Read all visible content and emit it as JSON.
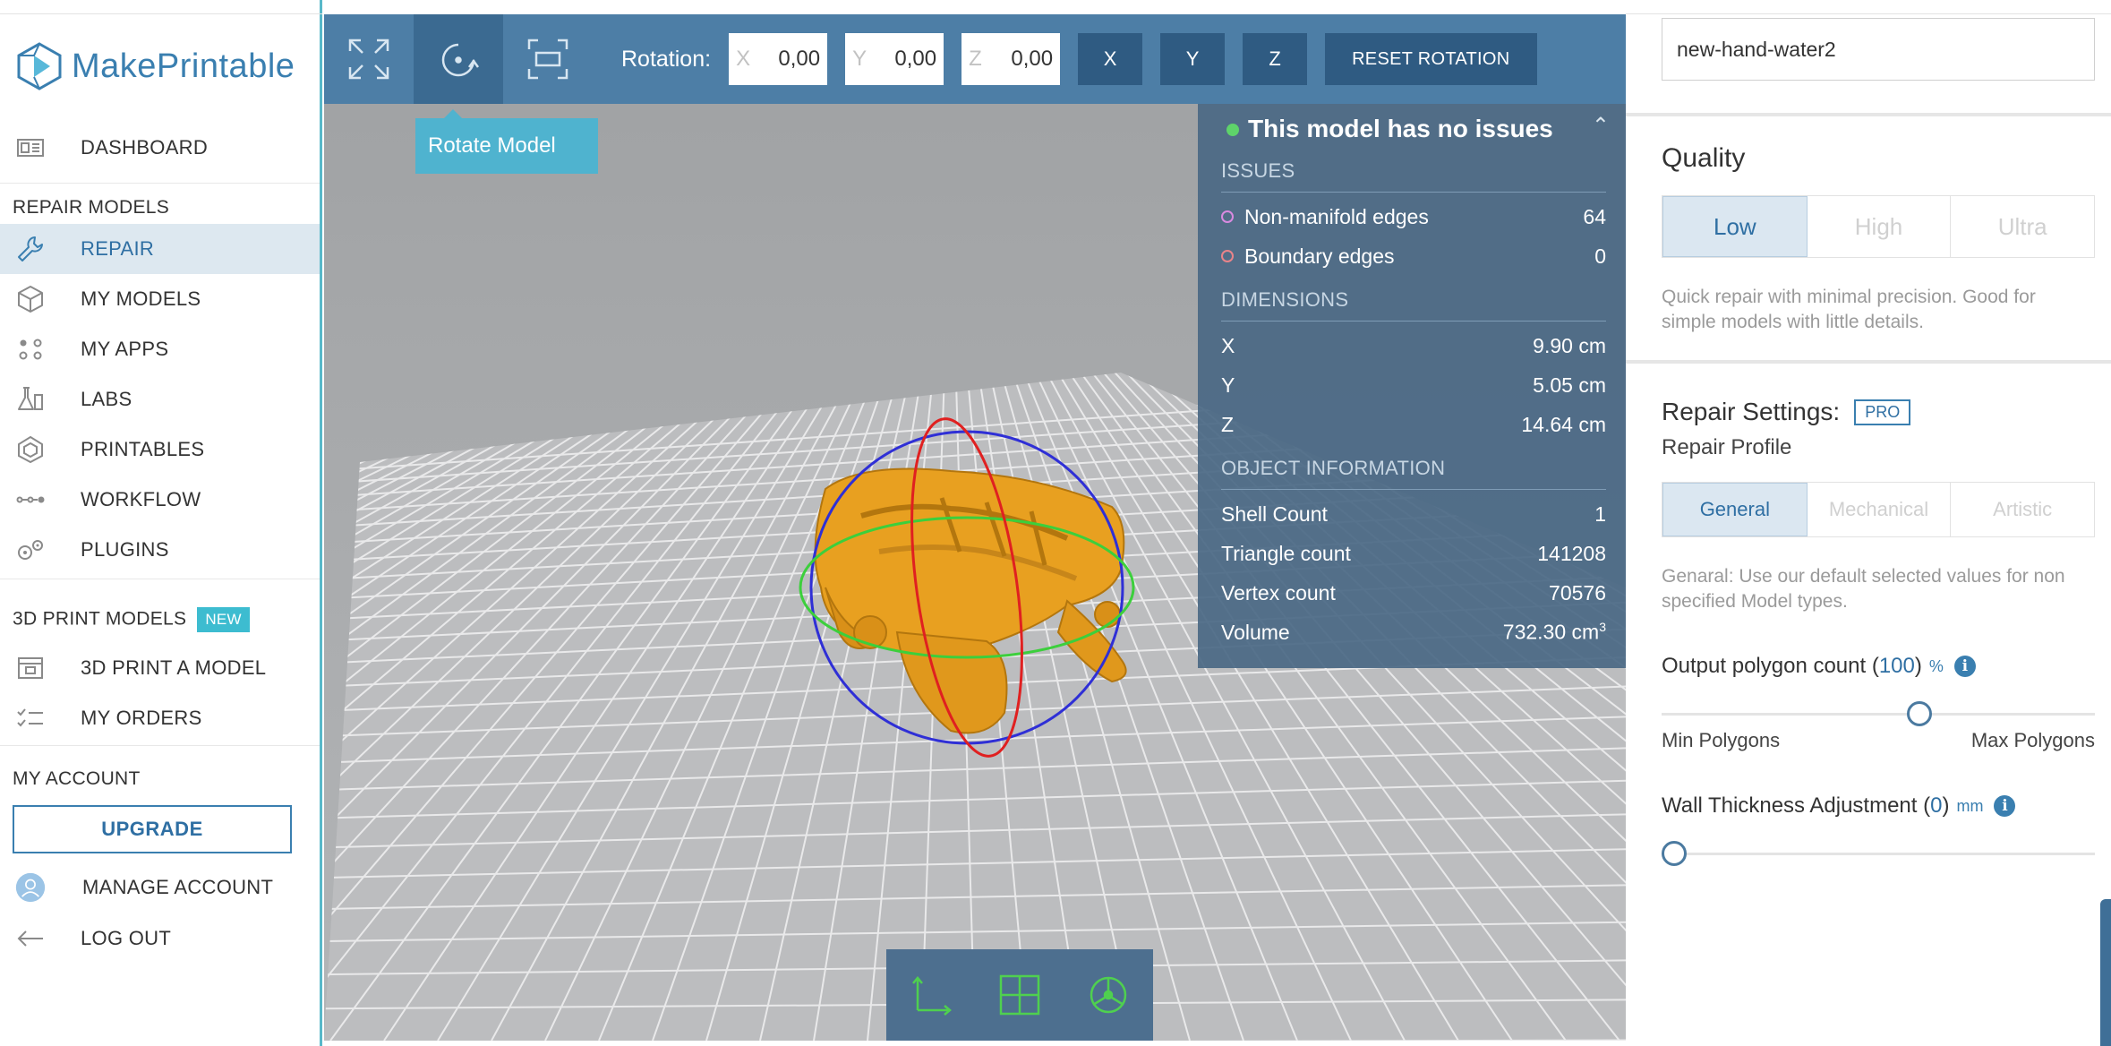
{
  "brand": {
    "name": "MakePrintable"
  },
  "sidebar": {
    "dashboard": "DASHBOARD",
    "repair_section": "REPAIR MODELS",
    "repair_items": [
      {
        "label": "REPAIR",
        "icon": "wrench-icon"
      },
      {
        "label": "MY MODELS",
        "icon": "cube-icon"
      },
      {
        "label": "MY APPS",
        "icon": "apps-icon"
      },
      {
        "label": "LABS",
        "icon": "flask-icon"
      },
      {
        "label": "PRINTABLES",
        "icon": "shape-icon"
      },
      {
        "label": "WORKFLOW",
        "icon": "workflow-icon"
      },
      {
        "label": "PLUGINS",
        "icon": "plugins-icon"
      }
    ],
    "print_section": "3D PRINT MODELS",
    "new_badge": "NEW",
    "print_items": [
      {
        "label": "3D PRINT A MODEL",
        "icon": "printer-icon"
      },
      {
        "label": "MY ORDERS",
        "icon": "checklist-icon"
      }
    ],
    "account_section": "MY ACCOUNT",
    "upgrade": "UPGRADE",
    "manage_account": "MANAGE ACCOUNT",
    "logout": "LOG OUT"
  },
  "toolbar": {
    "rotation_label": "Rotation:",
    "x_axis": "X",
    "x_value": "0,00",
    "y_axis": "Y",
    "y_value": "0,00",
    "z_axis": "Z",
    "z_value": "0,00",
    "btn_x": "X",
    "btn_y": "Y",
    "btn_z": "Z",
    "reset": "RESET ROTATION",
    "tooltip": "Rotate Model"
  },
  "info_panel": {
    "status": "This model has no issues",
    "issues_header": "ISSUES",
    "issues": [
      {
        "label": "Non-manifold edges",
        "value": "64",
        "color": "#d98ae0"
      },
      {
        "label": "Boundary edges",
        "value": "0",
        "color": "#e9848a"
      }
    ],
    "dimensions_header": "DIMENSIONS",
    "dimensions": [
      {
        "label": "X",
        "value": "9.90 cm"
      },
      {
        "label": "Y",
        "value": "5.05 cm"
      },
      {
        "label": "Z",
        "value": "14.64 cm"
      }
    ],
    "object_header": "OBJECT INFORMATION",
    "object": [
      {
        "label": "Shell Count",
        "value": "1"
      },
      {
        "label": "Triangle count",
        "value": "141208"
      },
      {
        "label": "Vertex count",
        "value": "70576"
      }
    ],
    "volume_label": "Volume",
    "volume_value": "732.30 cm",
    "volume_unit_sup": "3"
  },
  "right_panel": {
    "model_name": "new-hand-water2",
    "quality_title": "Quality",
    "quality_options": [
      "Low",
      "High",
      "Ultra"
    ],
    "quality_selected": "Low",
    "quality_desc": "Quick repair with minimal precision. Good for simple models with little details.",
    "repair_settings_title": "Repair Settings:",
    "pro_badge": "PRO",
    "repair_profile": "Repair Profile",
    "profile_options": [
      "General",
      "Mechanical",
      "Artistic"
    ],
    "profile_selected": "General",
    "profile_desc": "Genaral: Use our default selected values for non specified Model types.",
    "polygon_label": "Output polygon count (",
    "polygon_value": "100",
    "polygon_close": ")",
    "polygon_unit": "%",
    "polygon_slider_fraction": 0.6,
    "min_polygons": "Min Polygons",
    "max_polygons": "Max Polygons",
    "wall_label": "Wall Thickness Adjustment (",
    "wall_value": "0",
    "wall_close": ")",
    "wall_unit": "mm",
    "wall_slider_fraction": 0.0
  },
  "colors": {
    "accent": "#3a7fb0",
    "toolbar": "#4d7ea6",
    "info_panel": "#4a6884",
    "model": "#e8a020",
    "ok_status": "#5ed36a"
  }
}
